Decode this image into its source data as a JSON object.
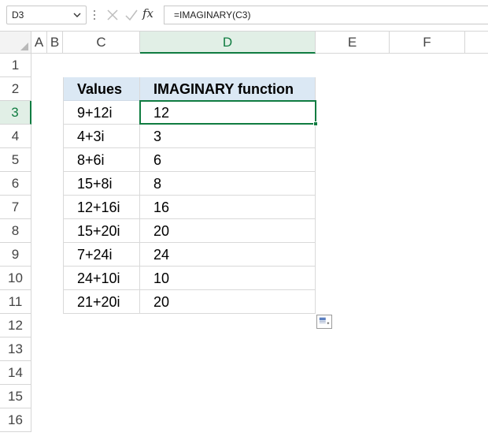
{
  "formula_bar": {
    "name_box": "D3",
    "formula": "=IMAGINARY(C3)",
    "fx_label": "fx"
  },
  "columns": [
    "A",
    "B",
    "C",
    "D",
    "E",
    "F"
  ],
  "active_column": "D",
  "rows": [
    "1",
    "2",
    "3",
    "4",
    "5",
    "6",
    "7",
    "8",
    "9",
    "10",
    "11",
    "12",
    "13",
    "14",
    "15",
    "16"
  ],
  "active_row": "3",
  "table": {
    "headers": [
      "Values",
      "IMAGINARY function"
    ],
    "rows": [
      [
        "9+12i",
        "12"
      ],
      [
        "4+3i",
        "3"
      ],
      [
        "8+6i",
        "6"
      ],
      [
        "15+8i",
        "8"
      ],
      [
        "12+16i",
        "16"
      ],
      [
        "15+20i",
        "20"
      ],
      [
        "7+24i",
        "24"
      ],
      [
        "24+10i",
        "10"
      ],
      [
        "21+20i",
        "20"
      ]
    ]
  },
  "colors": {
    "accent": "#107c41",
    "table_header_bg": "#dbe8f4"
  },
  "icons": {
    "cancel": "close-icon",
    "enter": "check-icon",
    "function": "function-icon",
    "quick_analysis": "quick-analysis-icon"
  }
}
